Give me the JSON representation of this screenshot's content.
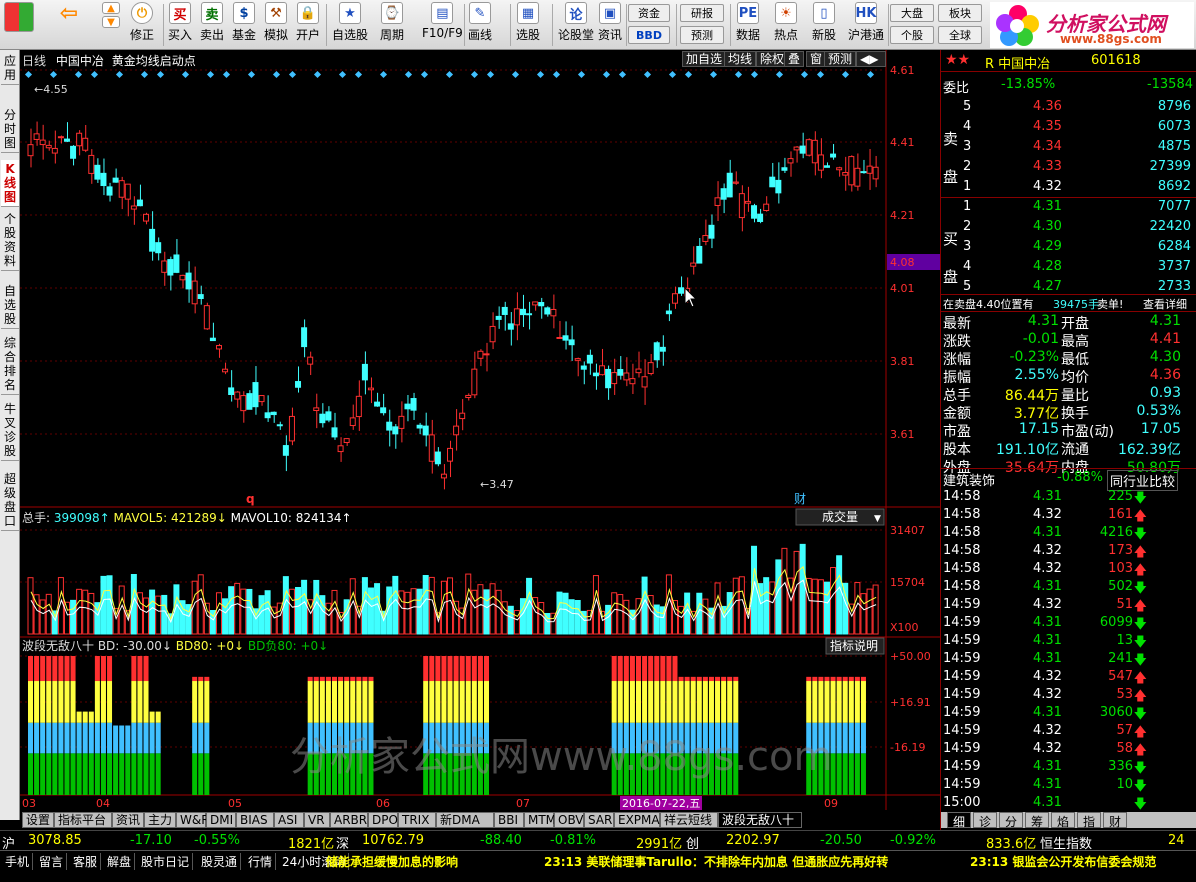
{
  "toolbar": [
    {
      "label": "买入",
      "icon": "买",
      "color": "#d00000"
    },
    {
      "label": "卖出",
      "icon": "卖",
      "color": "#007000"
    },
    {
      "label": "基金",
      "icon": "$",
      "color": "#0040a0"
    },
    {
      "label": "模拟",
      "icon": "⚒",
      "color": "#a04000"
    },
    {
      "label": "开户",
      "icon": "🔒",
      "color": "#806000"
    },
    {
      "label": "自选股",
      "icon": "★",
      "color": "#2050c0"
    },
    {
      "label": "周期",
      "icon": "⌚",
      "color": "#2050c0"
    },
    {
      "label": "F10/F9",
      "icon": "▤",
      "color": "#2050c0"
    },
    {
      "label": "画线",
      "icon": "✎",
      "color": "#2050c0"
    },
    {
      "label": "选股",
      "icon": "▦",
      "color": "#2050c0"
    },
    {
      "label": "论股堂",
      "icon": "论",
      "color": "#2050c0"
    },
    {
      "label": "资讯",
      "icon": "▣",
      "color": "#2050c0"
    },
    {
      "label": "数据",
      "icon": "PE",
      "color": "#2050c0"
    },
    {
      "label": "热点",
      "icon": "☀",
      "color": "#d04000"
    },
    {
      "label": "新股",
      "icon": "▯",
      "color": "#2050c0"
    },
    {
      "label": "沪港通",
      "icon": "HK",
      "color": "#2050c0"
    }
  ],
  "toolbar_small": {
    "zijin": "资金",
    "bbd": "BBD",
    "yanbao": "研报",
    "yuce": "预测",
    "dapan": "大盘",
    "bankuai": "板块",
    "gegu": "个股",
    "quanqiu": "全球",
    "back": "修正",
    "fwd": "",
    "cmd": "修正"
  },
  "logo": {
    "title": "分析家公式网",
    "url": "www.88gs.com"
  },
  "left_tabs": [
    "应用",
    "分时图",
    "K线图",
    "个股资料",
    "自选股",
    "综合排名",
    "牛叉诊股",
    "超级盘口"
  ],
  "chart": {
    "period": "日线",
    "name": "中国中冶",
    "formula": "黄金均线启动点",
    "buttons": [
      "加自选",
      "均线",
      "除权",
      "叠",
      "窗",
      "预测"
    ],
    "price_ticks": [
      "4.61",
      "4.41",
      "4.21",
      "4.01",
      "3.81",
      "3.61"
    ],
    "current_price_tag": "4.08",
    "high_label": "4.55",
    "low_label": "3.47",
    "marker_q": "q",
    "marker_cai": "财",
    "vol_info": {
      "prefix": "总手:",
      "v": "399098",
      "m5": "MAVOL5: 421289",
      "m10": "MAVOL10: 824134"
    },
    "vol_select": "成交量",
    "vol_ticks": [
      "31407",
      "15704"
    ],
    "vol_unit": "X100",
    "ind_info": {
      "name": "波段无敌八十",
      "bd": "BD: -30.00",
      "bd80": "BD80: +0",
      "bdneg": "BD负80: +0"
    },
    "ind_btn": "指标说明",
    "ind_ticks": [
      "+50.00",
      "+16.91",
      "-16.19"
    ],
    "months": [
      "03",
      "04",
      "05",
      "06",
      "07",
      "09"
    ],
    "date_tag": "2016-07-22,五",
    "watermark": "分析家公式网www.88gs.com"
  },
  "bottom_tabs": [
    "设置",
    "指标平台",
    "资讯",
    "主力",
    "W&R",
    "DMI",
    "BIAS",
    "ASI",
    "VR",
    "ARBR",
    "DPO",
    "TRIX",
    "新DMA",
    "BBI",
    "MTM",
    "OBV",
    "SAR",
    "EXPMA",
    "祥云短线",
    "波段无敌八十"
  ],
  "right": {
    "stars": "★★",
    "code_name": "R 中国中冶",
    "code": "601618",
    "weibi_label": "委比",
    "weibi": "-13.85%",
    "weicha": "-13584",
    "sell_label": "卖盘",
    "buy_label": "买盘",
    "sells": [
      [
        "5",
        "4.36",
        "8796"
      ],
      [
        "4",
        "4.35",
        "6073"
      ],
      [
        "3",
        "4.34",
        "4875"
      ],
      [
        "2",
        "4.33",
        "27399"
      ],
      [
        "1",
        "4.32",
        "8692"
      ]
    ],
    "buys": [
      [
        "1",
        "4.31",
        "7077"
      ],
      [
        "2",
        "4.30",
        "22420"
      ],
      [
        "3",
        "4.29",
        "6284"
      ],
      [
        "4",
        "4.28",
        "3737"
      ],
      [
        "5",
        "4.27",
        "2733"
      ]
    ],
    "notice": "在卖盘4.40位置有",
    "notice_vol": "39475手",
    "notice_tail": "卖单!",
    "notice_link": "查看详细",
    "stats": [
      [
        "最新",
        "4.31",
        "开盘",
        "4.31"
      ],
      [
        "涨跌",
        "-0.01",
        "最高",
        "4.41"
      ],
      [
        "涨幅",
        "-0.23%",
        "最低",
        "4.30"
      ],
      [
        "振幅",
        "2.55%",
        "均价",
        "4.36"
      ],
      [
        "总手",
        "86.44万",
        "量比",
        "0.93"
      ],
      [
        "金额",
        "3.77亿",
        "换手",
        "0.53%"
      ],
      [
        "市盈",
        "17.15",
        "市盈(动)",
        "17.05"
      ],
      [
        "股本",
        "191.10亿",
        "流通",
        "162.39亿"
      ],
      [
        "外盘",
        "35.64万",
        "内盘",
        "50.80万"
      ]
    ],
    "industry": "建筑装饰",
    "industry_pct": "-0.88%",
    "industry_btn": "同行业比较",
    "ticks": [
      [
        "14:58",
        "4.31",
        "225",
        "dn"
      ],
      [
        "14:58",
        "4.32",
        "161",
        "up"
      ],
      [
        "14:58",
        "4.31",
        "4216",
        "dn"
      ],
      [
        "14:58",
        "4.32",
        "173",
        "up"
      ],
      [
        "14:58",
        "4.32",
        "103",
        "up"
      ],
      [
        "14:58",
        "4.31",
        "502",
        "dn"
      ],
      [
        "14:59",
        "4.32",
        "51",
        "up"
      ],
      [
        "14:59",
        "4.31",
        "6099",
        "dn"
      ],
      [
        "14:59",
        "4.31",
        "13",
        "dn"
      ],
      [
        "14:59",
        "4.31",
        "241",
        "dn"
      ],
      [
        "14:59",
        "4.32",
        "547",
        "up"
      ],
      [
        "14:59",
        "4.32",
        "53",
        "up"
      ],
      [
        "14:59",
        "4.31",
        "3060",
        "dn"
      ],
      [
        "14:59",
        "4.32",
        "57",
        "up"
      ],
      [
        "14:59",
        "4.32",
        "58",
        "up"
      ],
      [
        "14:59",
        "4.31",
        "336",
        "dn"
      ],
      [
        "14:59",
        "4.31",
        "10",
        "dn"
      ],
      [
        "15:00",
        "4.31",
        "",
        "dn"
      ]
    ],
    "tabs": [
      "细",
      "诊",
      "分",
      "筹",
      "焰",
      "指",
      "财"
    ]
  },
  "status": {
    "sh_label": "沪",
    "sh": "3078.85",
    "sh_chg": "-17.10",
    "sh_pct": "-0.55%",
    "sh_amt": "1821亿",
    "sz_label": "深",
    "sz": "10762.79",
    "sz_chg": "-88.40",
    "sz_pct": "-0.81%",
    "sz_amt": "2991亿",
    "cy_label": "创",
    "cy": "2202.97",
    "cy_chg": "-20.50",
    "cy_pct": "-0.92%",
    "cy_amt": "833.6亿",
    "hs_label": "恒生指数",
    "hs": "24"
  },
  "status2": {
    "buttons": [
      "手机",
      "留言",
      "客服",
      "解盘",
      "股市日记",
      "股灵通",
      "行情",
      "24小时滚动"
    ],
    "news1": "储能承担缓慢加息的影响",
    "news2": "23:13 美联储理事Tarullo：不排除年内加息 但通胀应先再好转",
    "news3": "23:13 银监会公开发布信委会规范"
  }
}
